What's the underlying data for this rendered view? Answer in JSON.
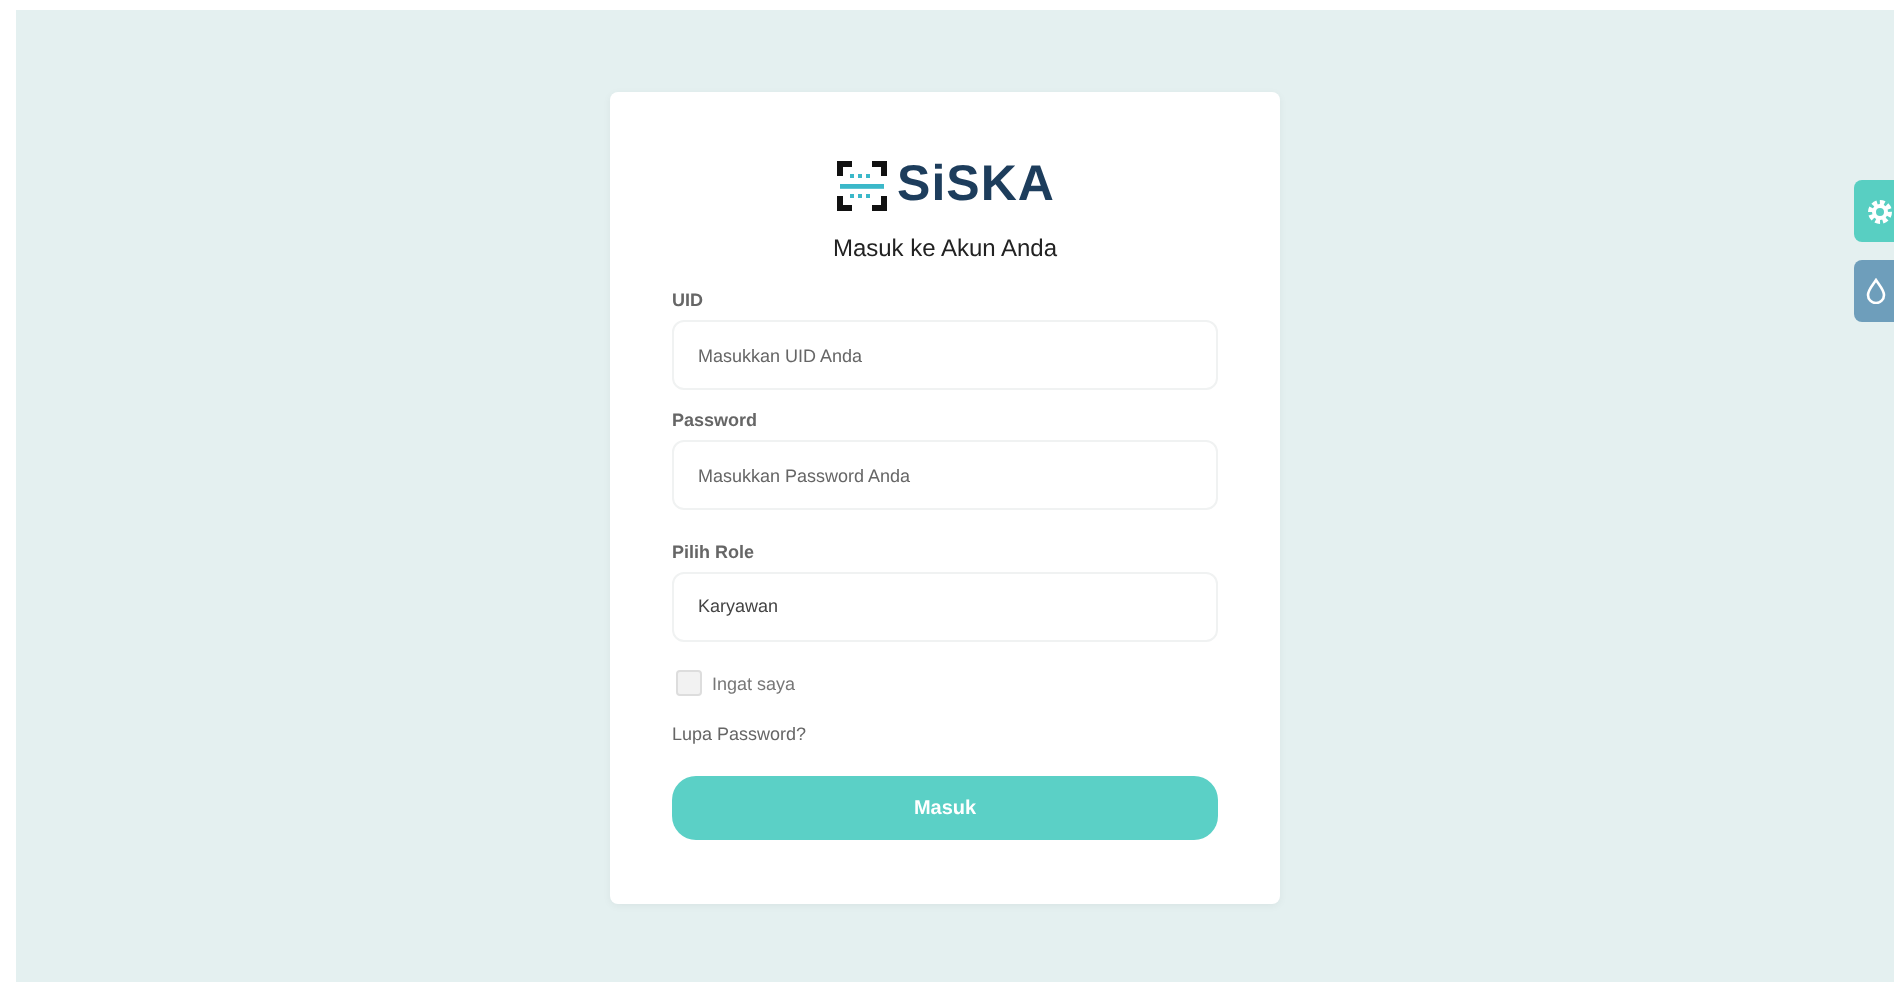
{
  "logo": {
    "text": "SiSKA"
  },
  "heading": "Masuk ke Akun Anda",
  "fields": [
    {
      "label": "UID",
      "placeholder": "Masukkan UID Anda",
      "kind": "text"
    },
    {
      "label": "Password",
      "placeholder": "Masukkan Password Anda",
      "kind": "password"
    },
    {
      "label": "Pilih Role",
      "value": "Karyawan",
      "kind": "select"
    }
  ],
  "remember": {
    "label": "Ingat saya",
    "checked": false
  },
  "forgot_link": "Lupa Password?",
  "submit": "Masuk",
  "side_buttons": [
    {
      "kind": "settings"
    },
    {
      "kind": "theme"
    }
  ]
}
